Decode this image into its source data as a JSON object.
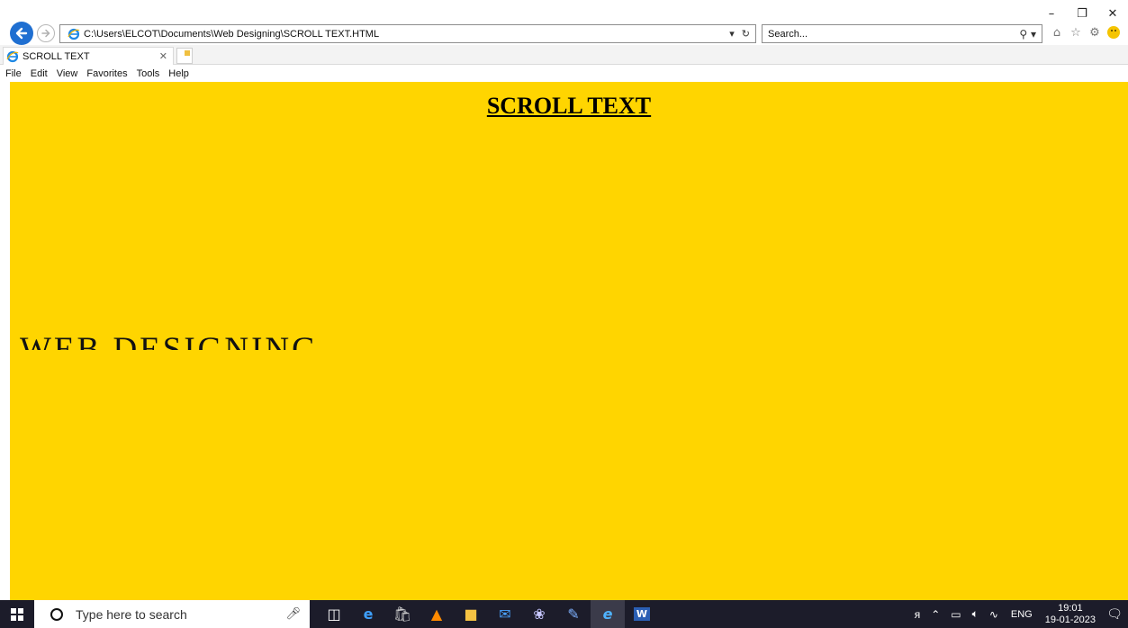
{
  "window": {
    "minimize_icon": "minimize-icon",
    "restore_icon": "restore-icon",
    "close_icon": "close-icon"
  },
  "address_bar": {
    "url": "C:\\Users\\ELCOT\\Documents\\Web Designing\\SCROLL TEXT.HTML",
    "search_placeholder": "Search..."
  },
  "tab": {
    "title": "SCROLL TEXT"
  },
  "menu": [
    "File",
    "Edit",
    "View",
    "Favorites",
    "Tools",
    "Help"
  ],
  "page": {
    "background": "#ffd500",
    "heading": "SCROLL TEXT",
    "marquee_text": "WEB DESIGNING"
  },
  "taskbar": {
    "search_placeholder": "Type here to search",
    "language": "ENG",
    "time": "19:01",
    "date": "19-01-2023"
  },
  "colors": {
    "accent": "#1f6fd1",
    "taskbar": "#1c1c2a"
  }
}
